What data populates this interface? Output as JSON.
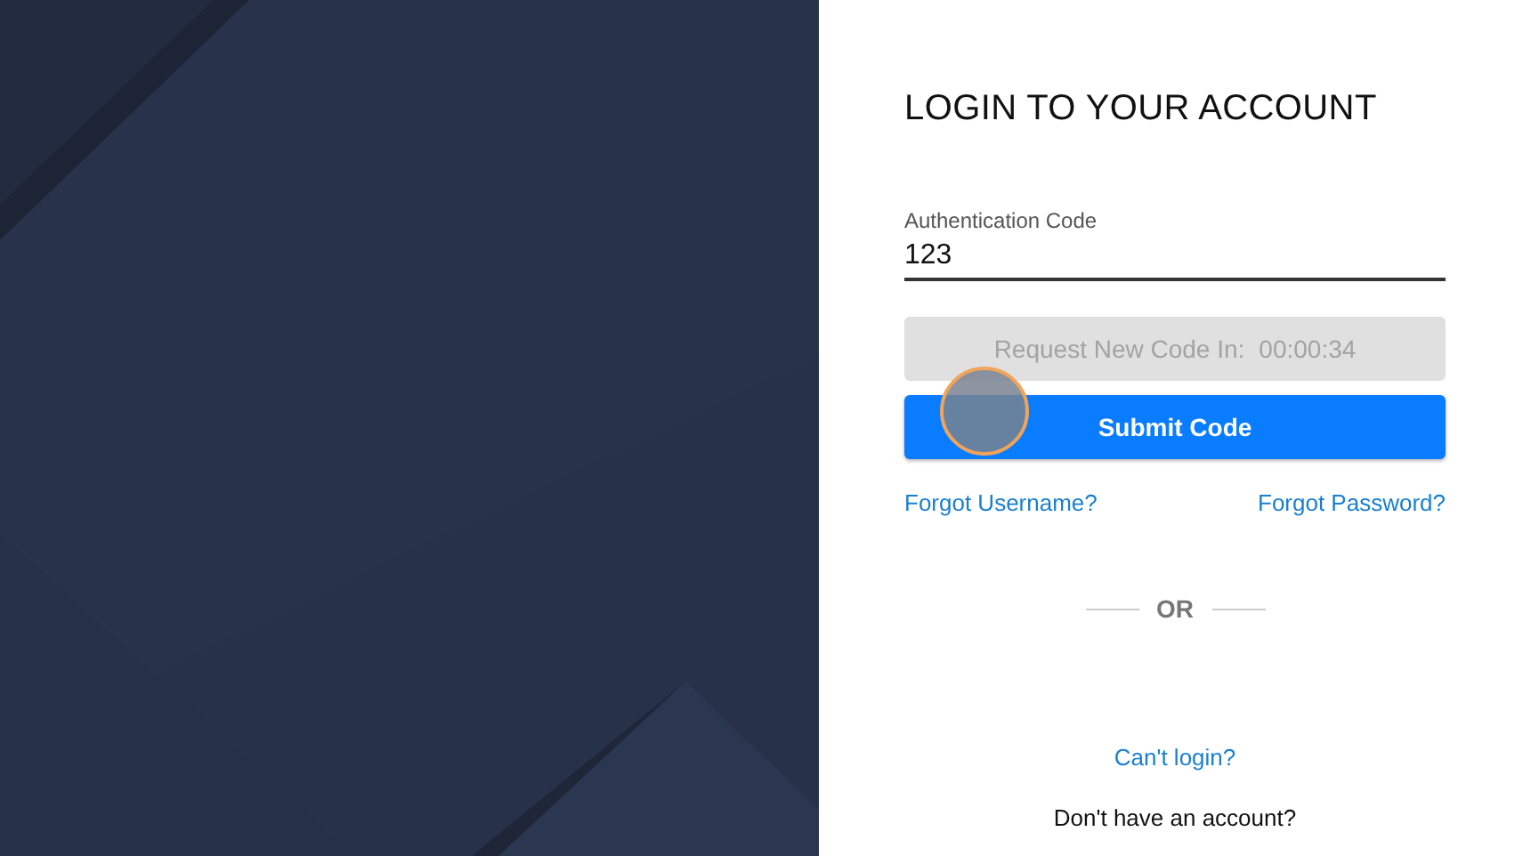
{
  "login": {
    "title": "LOGIN TO YOUR ACCOUNT",
    "code_field": {
      "label": "Authentication Code",
      "value": "123",
      "focused": true
    },
    "request_button": {
      "label": "Request New Code In:",
      "countdown": "00:00:34",
      "disabled": true
    },
    "submit_button": {
      "label": "Submit Code",
      "disabled": false
    },
    "links": [
      "Forgot Username?",
      "Forgot Password?"
    ],
    "divider": "OR",
    "cant_login": "Can't login?",
    "signup_prompt": "Don't have an account?"
  }
}
